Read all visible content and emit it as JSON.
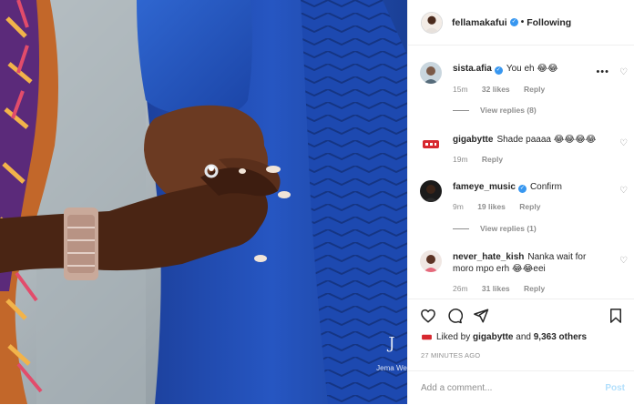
{
  "photo": {
    "watermark_text": "Jema We",
    "watermark_mark": "J"
  },
  "header": {
    "username": "fellamakafui",
    "verified_icon": "verified-badge-icon",
    "separator": "•",
    "follow_state": "Following"
  },
  "comments": [
    {
      "username": "sista.afia",
      "verified": true,
      "text": "You eh 😂😂",
      "time": "15m",
      "likes": "32 likes",
      "reply": "Reply",
      "view_replies": "View replies (8)",
      "has_more": "•••"
    },
    {
      "username": "gigabytte",
      "verified": false,
      "text": "Shade paaaa 😂😂😂😂",
      "time": "19m",
      "likes": "",
      "reply": "Reply"
    },
    {
      "username": "fameye_music",
      "verified": true,
      "text": "Confirm",
      "time": "9m",
      "likes": "19 likes",
      "reply": "Reply",
      "view_replies": "View replies (1)"
    },
    {
      "username": "never_hate_kish",
      "verified": false,
      "text": "Nanka wait for moro mpo erh 😂😂eei",
      "time": "26m",
      "likes": "31 likes",
      "reply": "Reply"
    }
  ],
  "actions": {
    "icons": [
      "heart-icon",
      "comment-icon",
      "share-icon",
      "bookmark-icon"
    ],
    "liked_by_prefix": "Liked by",
    "liked_by_user": "gigabytte",
    "liked_by_and": "and",
    "liked_by_count": "9,363 others",
    "time_ago": "27 MINUTES AGO",
    "comment_placeholder": "Add a comment...",
    "post_button": "Post"
  },
  "colors": {
    "verified": "#3897f0",
    "muted": "#8e8e8e",
    "post_button_disabled": "#b2dffc",
    "suit_blue": "#1f4fb0"
  }
}
